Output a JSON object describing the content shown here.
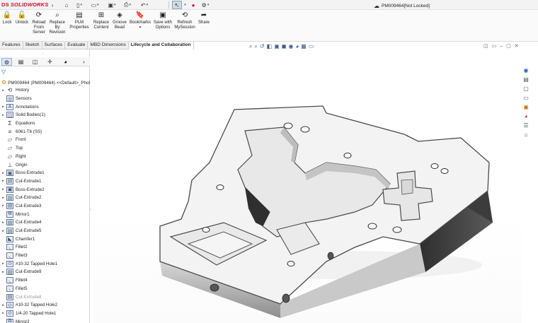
{
  "app": {
    "brand": "SOLIDWORKS",
    "brand_mark": "DS",
    "document_title": "PM009464[Not Locked]"
  },
  "quick_access": {
    "icons": [
      "home-icon",
      "new-document-icon",
      "open-icon",
      "save-icon",
      "print-icon",
      "undo-icon",
      "select-icon",
      "rebuild-icon",
      "options-icon"
    ]
  },
  "ribbon": {
    "buttons": [
      {
        "label": "Lock",
        "icon": "lock-icon"
      },
      {
        "label": "Unlock",
        "icon": "unlock-icon"
      },
      {
        "label": "Reload From Server",
        "icon": "reload-icon"
      },
      {
        "label": "Replace By Revision",
        "icon": "replace-revision-icon"
      },
      {
        "label": "PLM Properties",
        "icon": "plm-properties-icon"
      },
      {
        "label": "Replace Content",
        "icon": "replace-content-icon"
      },
      {
        "label": "Groove Bead",
        "icon": "groove-bead-icon"
      },
      {
        "label": "Bookmarks",
        "icon": "bookmark-icon"
      },
      {
        "label": "Save with Options",
        "icon": "save-options-icon"
      },
      {
        "label": "Refresh MySession",
        "icon": "refresh-icon"
      },
      {
        "label": "Share",
        "icon": "share-icon"
      }
    ]
  },
  "command_tabs": [
    "Features",
    "Sketch",
    "Surfaces",
    "Evaluate",
    "MBD Dimensions",
    "Lifecycle and Collaboration"
  ],
  "active_tab": "Lifecycle and Collaboration",
  "feature_manager": {
    "root": "PM009464 (PM009464) <<Default>_Phot",
    "items": [
      {
        "label": "History",
        "expandable": true,
        "icon": "history-icon"
      },
      {
        "label": "Sensors",
        "expandable": false,
        "icon": "sensor-icon"
      },
      {
        "label": "Annotations",
        "expandable": true,
        "icon": "annotations-icon"
      },
      {
        "label": "Solid Bodies(1)",
        "expandable": true,
        "icon": "solid-bodies-icon"
      },
      {
        "label": "Equations",
        "expandable": false,
        "icon": "equations-icon"
      },
      {
        "label": "6061-T6 (SS)",
        "expandable": false,
        "icon": "material-icon"
      },
      {
        "label": "Front",
        "expandable": false,
        "icon": "plane-icon"
      },
      {
        "label": "Top",
        "expandable": false,
        "icon": "plane-icon"
      },
      {
        "label": "Right",
        "expandable": false,
        "icon": "plane-icon"
      },
      {
        "label": "Origin",
        "expandable": false,
        "icon": "origin-icon"
      },
      {
        "label": "Boss-Extrude1",
        "expandable": true,
        "icon": "extrude-icon"
      },
      {
        "label": "Cut-Extrude1",
        "expandable": true,
        "icon": "cut-extrude-icon"
      },
      {
        "label": "Boss-Extrude2",
        "expandable": true,
        "icon": "extrude-icon"
      },
      {
        "label": "Cut-Extrude2",
        "expandable": true,
        "icon": "cut-extrude-icon"
      },
      {
        "label": "Cut-Extrude3",
        "expandable": true,
        "icon": "cut-extrude-icon"
      },
      {
        "label": "Mirror1",
        "expandable": false,
        "icon": "mirror-icon"
      },
      {
        "label": "Cut-Extrude4",
        "expandable": true,
        "icon": "cut-extrude-icon"
      },
      {
        "label": "Cut-Extrude5",
        "expandable": true,
        "icon": "cut-extrude-icon"
      },
      {
        "label": "Chamfer1",
        "expandable": false,
        "icon": "chamfer-icon"
      },
      {
        "label": "Fillet2",
        "expandable": false,
        "icon": "fillet-icon"
      },
      {
        "label": "Fillet3",
        "expandable": false,
        "icon": "fillet-icon"
      },
      {
        "label": "#10-32 Tapped Hole1",
        "expandable": true,
        "icon": "hole-icon"
      },
      {
        "label": "Cut-Extrude9",
        "expandable": true,
        "icon": "cut-extrude-icon"
      },
      {
        "label": "Fillet4",
        "expandable": false,
        "icon": "fillet-icon"
      },
      {
        "label": "Fillet5",
        "expandable": false,
        "icon": "fillet-icon"
      },
      {
        "label": "Cut-Extrude8",
        "expandable": false,
        "icon": "cut-extrude-icon",
        "suppressed": true
      },
      {
        "label": "#10-32 Tapped Hole2",
        "expandable": true,
        "icon": "hole-icon"
      },
      {
        "label": "1/4-20 Tapped Hole1",
        "expandable": true,
        "icon": "hole-icon"
      },
      {
        "label": "Mirror2",
        "expandable": false,
        "icon": "mirror-icon"
      }
    ]
  },
  "colors": {
    "brand": "#c8102e",
    "part_face": "#f2f2f2",
    "part_side": "#b8b8b8",
    "part_shadow": "#3a3a3a"
  }
}
